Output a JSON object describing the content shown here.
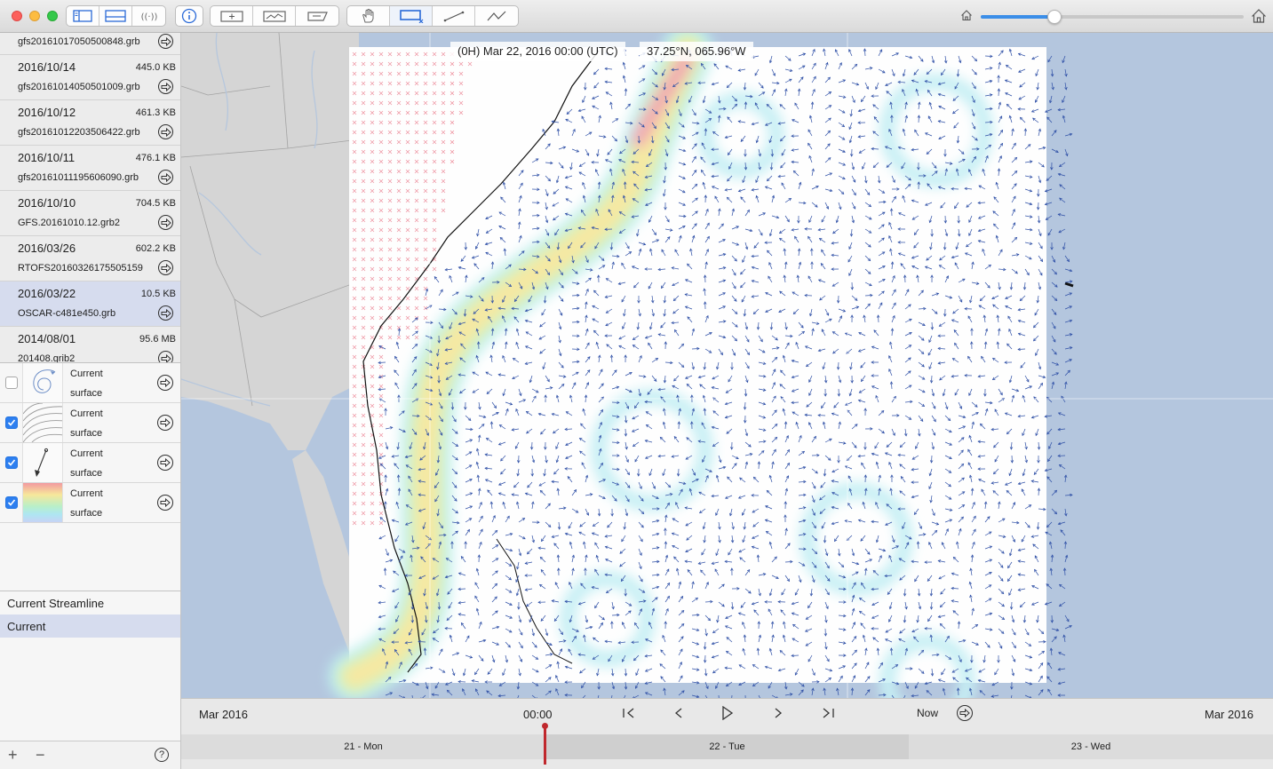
{
  "toolbar": {
    "window_buttons": [
      "close",
      "minimize",
      "zoom"
    ],
    "group1": [
      "sidebar-left-icon",
      "sidebar-bottom-icon",
      "broadcast-icon"
    ],
    "group2": [
      "info-icon"
    ],
    "group3": [
      "add-box-icon",
      "chart-box-icon",
      "ruler-box-icon"
    ],
    "group4": [
      "hand-icon",
      "select-rect-icon",
      "line-tool-icon",
      "polyline-tool-icon"
    ],
    "zoom_level": 0.28,
    "colors": {
      "accent": "#3b8ee8"
    }
  },
  "files": [
    {
      "date": "",
      "size": "",
      "name": "gfs20161017050500848.grb"
    },
    {
      "date": "2016/10/14",
      "size": "445.0 KB",
      "name": "gfs20161014050501009.grb"
    },
    {
      "date": "2016/10/12",
      "size": "461.3 KB",
      "name": "gfs20161012203506422.grb"
    },
    {
      "date": "2016/10/11",
      "size": "476.1 KB",
      "name": "gfs20161011195606090.grb"
    },
    {
      "date": "2016/10/10",
      "size": "704.5 KB",
      "name": "GFS.20161010.12.grb2"
    },
    {
      "date": "2016/03/26",
      "size": "602.2 KB",
      "name": "RTOFS20160326175505159"
    },
    {
      "date": "2016/03/22",
      "size": "10.5 KB",
      "name": "OSCAR-c481e450.grb"
    },
    {
      "date": "2014/08/01",
      "size": "95.6 MB",
      "name": "201408.grib2"
    }
  ],
  "layers": [
    {
      "name": "Current",
      "sub": "surface",
      "checked": false,
      "thumb": "streamline"
    },
    {
      "name": "Current",
      "sub": "surface",
      "checked": true,
      "thumb": "contour"
    },
    {
      "name": "Current",
      "sub": "surface",
      "checked": true,
      "thumb": "arrow"
    },
    {
      "name": "Current",
      "sub": "surface",
      "checked": true,
      "thumb": "gradient"
    }
  ],
  "overlays": [
    {
      "label": "Current Streamline",
      "selected": false
    },
    {
      "label": "Current",
      "selected": true
    }
  ],
  "footer": {
    "add": "+",
    "remove": "−",
    "help": "?"
  },
  "map": {
    "time_label": "(0H) Mar 22, 2016 00:00 (UTC)",
    "coord_label": "37.25°N, 065.96°W",
    "colors": {
      "ocean": "#b4c6de",
      "land": "#d5d5d5",
      "arrows": "#2e4fa6",
      "strong_current": "#ef9aa6"
    }
  },
  "timeline": {
    "left_label": "Mar 2016",
    "time": "00:00",
    "now_label": "Now",
    "right_label": "Mar 2016",
    "days": [
      "21 - Mon",
      "22 - Tue",
      "23 - Wed"
    ]
  }
}
